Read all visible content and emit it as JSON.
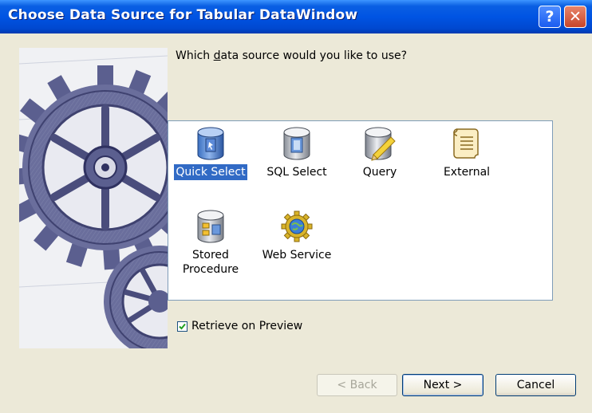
{
  "window": {
    "title": "Choose Data Source for Tabular DataWindow",
    "help_label": "?",
    "close_label": "✕"
  },
  "prompt": {
    "before": "Which ",
    "underlined": "d",
    "after": "ata source would you like to use?"
  },
  "sources": [
    {
      "label": "Quick Select",
      "icon": "quick-select-icon",
      "selected": true
    },
    {
      "label": "SQL Select",
      "icon": "sql-select-icon",
      "selected": false
    },
    {
      "label": "Query",
      "icon": "query-icon",
      "selected": false
    },
    {
      "label": "External",
      "icon": "external-icon",
      "selected": false
    },
    {
      "label": "Stored Procedure",
      "line1": "Stored",
      "line2": "Procedure",
      "icon": "stored-procedure-icon",
      "selected": false
    },
    {
      "label": "Web Service",
      "icon": "web-service-icon",
      "selected": false
    }
  ],
  "retrieve": {
    "label": "Retrieve on Preview",
    "checked": true
  },
  "buttons": {
    "back": "< Back",
    "next": "Next >",
    "cancel": "Cancel"
  },
  "colors": {
    "selection": "#316ac5",
    "titlebar": "#0054e3",
    "face": "#ece9d8"
  }
}
